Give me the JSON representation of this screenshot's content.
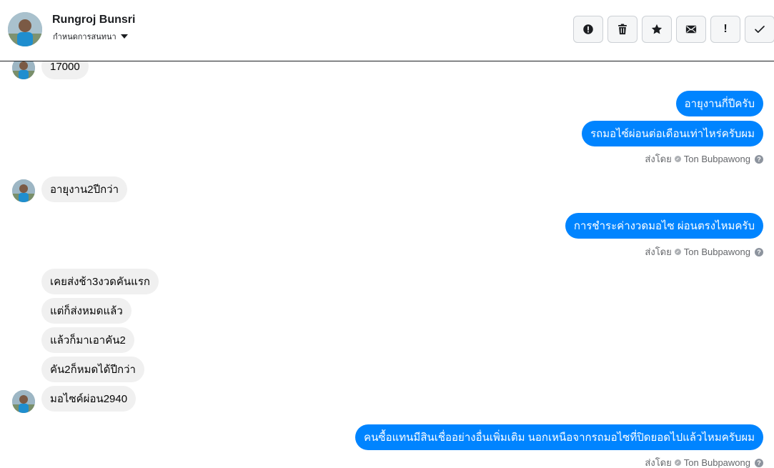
{
  "header": {
    "name": "Rungroj Bunsri",
    "subtitle": "กำหนดการสนทนา",
    "actions": [
      {
        "label": "report-icon"
      },
      {
        "label": "trash-icon"
      },
      {
        "label": "star-icon"
      },
      {
        "label": "mail-icon"
      },
      {
        "label": "!"
      },
      {
        "label": "check-icon"
      }
    ]
  },
  "messages": {
    "m1": "17000",
    "m2": "อายุงานกี่ปีครับ",
    "m3": "รถมอไซ์ผ่อนต่อเดือนเท่าไหร่ครับผม",
    "m4": "อายุงาน2ปีกว่า",
    "m5": "การชำระค่างวดมอไซ ผ่อนตรงไหมครับ",
    "m6": "เคยส่งช้า3งวดคันแรก",
    "m7": "แต่ก็ส่งหมดแล้ว",
    "m8": "แล้วก็มาเอาคัน2",
    "m9": "คัน2ก็หมดได้ปีกว่า",
    "m10": "มอไซค์ผ่อน2940",
    "m11": "คนซื้อแทนมีสินเชื่ออย่างอื่นเพิ่มเติม นอกเหนือจากรถมอไซที่ปิดยอดไปแล้วไหมครับผม"
  },
  "sent_by": {
    "prefix": "ส่งโดย",
    "agent": "Ton Bubpawong",
    "help": "?"
  },
  "colors": {
    "outgoing": "#0084ff",
    "incoming": "#f0f0f0"
  }
}
